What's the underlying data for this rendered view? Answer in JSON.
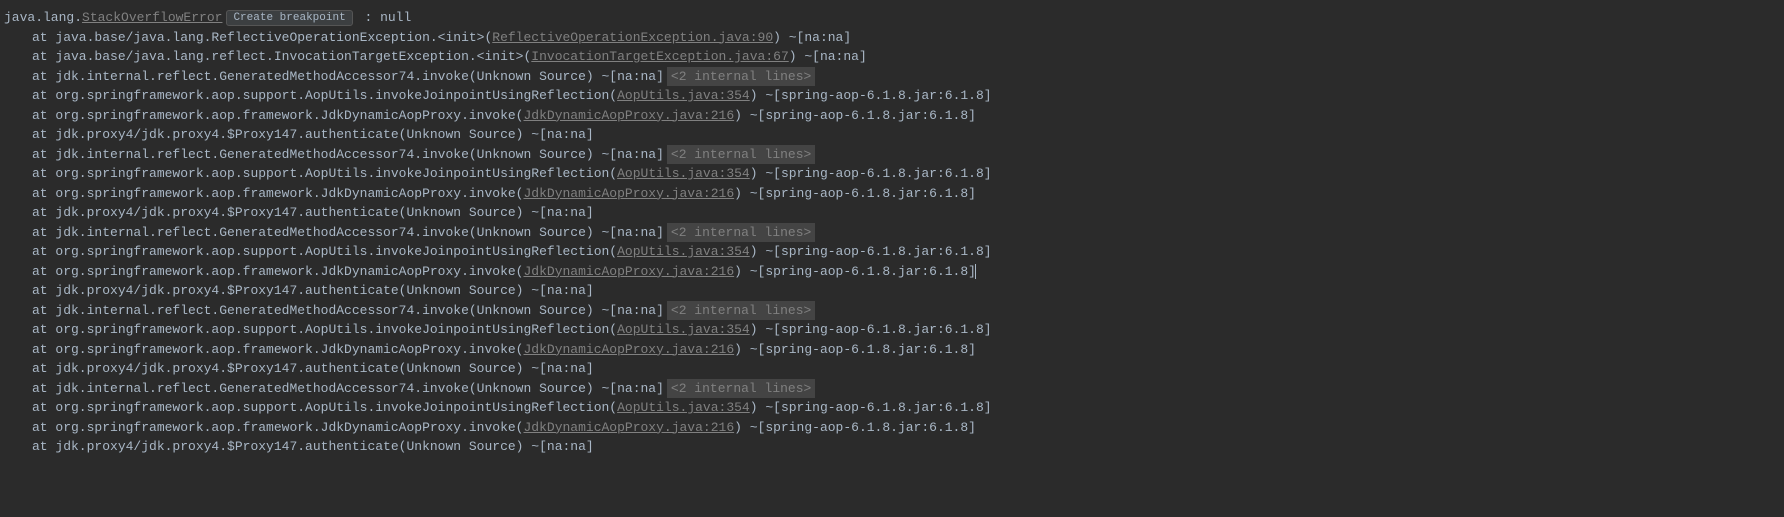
{
  "exception": {
    "packagePrefix": "java.lang.",
    "className": "StackOverflowError",
    "createBreakpointLabel": "Create breakpoint",
    "messageSuffix": " : null"
  },
  "atLabel": "at ",
  "internalLinesBadge": "<2 internal lines>",
  "frames": [
    {
      "prefix": "java.base/java.lang.ReflectiveOperationException.<init>(",
      "linkText": "ReflectiveOperationException.java:90",
      "suffix": ") ~[na:na]",
      "hasBadge": false
    },
    {
      "prefix": "java.base/java.lang.reflect.InvocationTargetException.<init>(",
      "linkText": "InvocationTargetException.java:67",
      "suffix": ") ~[na:na]",
      "hasBadge": false
    },
    {
      "prefix": "jdk.internal.reflect.GeneratedMethodAccessor74.invoke(Unknown Source) ~[na:na]",
      "linkText": "",
      "suffix": "",
      "hasBadge": true
    },
    {
      "prefix": "org.springframework.aop.support.AopUtils.invokeJoinpointUsingReflection(",
      "linkText": "AopUtils.java:354",
      "suffix": ") ~[spring-aop-6.1.8.jar:6.1.8]",
      "hasBadge": false
    },
    {
      "prefix": "org.springframework.aop.framework.JdkDynamicAopProxy.invoke(",
      "linkText": "JdkDynamicAopProxy.java:216",
      "suffix": ") ~[spring-aop-6.1.8.jar:6.1.8]",
      "hasBadge": false
    },
    {
      "prefix": "jdk.proxy4/jdk.proxy4.$Proxy147.authenticate(Unknown Source) ~[na:na]",
      "linkText": "",
      "suffix": "",
      "hasBadge": false
    },
    {
      "prefix": "jdk.internal.reflect.GeneratedMethodAccessor74.invoke(Unknown Source) ~[na:na]",
      "linkText": "",
      "suffix": "",
      "hasBadge": true
    },
    {
      "prefix": "org.springframework.aop.support.AopUtils.invokeJoinpointUsingReflection(",
      "linkText": "AopUtils.java:354",
      "suffix": ") ~[spring-aop-6.1.8.jar:6.1.8]",
      "hasBadge": false
    },
    {
      "prefix": "org.springframework.aop.framework.JdkDynamicAopProxy.invoke(",
      "linkText": "JdkDynamicAopProxy.java:216",
      "suffix": ") ~[spring-aop-6.1.8.jar:6.1.8]",
      "hasBadge": false
    },
    {
      "prefix": "jdk.proxy4/jdk.proxy4.$Proxy147.authenticate(Unknown Source) ~[na:na]",
      "linkText": "",
      "suffix": "",
      "hasBadge": false
    },
    {
      "prefix": "jdk.internal.reflect.GeneratedMethodAccessor74.invoke(Unknown Source) ~[na:na]",
      "linkText": "",
      "suffix": "",
      "hasBadge": true
    },
    {
      "prefix": "org.springframework.aop.support.AopUtils.invokeJoinpointUsingReflection(",
      "linkText": "AopUtils.java:354",
      "suffix": ") ~[spring-aop-6.1.8.jar:6.1.8]",
      "hasBadge": false
    },
    {
      "prefix": "org.springframework.aop.framework.JdkDynamicAopProxy.invoke(",
      "linkText": "JdkDynamicAopProxy.java:216",
      "suffix": ") ~[spring-aop-6.1.8.jar:6.1.8]",
      "hasBadge": false,
      "hasCursor": true
    },
    {
      "prefix": "jdk.proxy4/jdk.proxy4.$Proxy147.authenticate(Unknown Source) ~[na:na]",
      "linkText": "",
      "suffix": "",
      "hasBadge": false
    },
    {
      "prefix": "jdk.internal.reflect.GeneratedMethodAccessor74.invoke(Unknown Source) ~[na:na]",
      "linkText": "",
      "suffix": "",
      "hasBadge": true
    },
    {
      "prefix": "org.springframework.aop.support.AopUtils.invokeJoinpointUsingReflection(",
      "linkText": "AopUtils.java:354",
      "suffix": ") ~[spring-aop-6.1.8.jar:6.1.8]",
      "hasBadge": false
    },
    {
      "prefix": "org.springframework.aop.framework.JdkDynamicAopProxy.invoke(",
      "linkText": "JdkDynamicAopProxy.java:216",
      "suffix": ") ~[spring-aop-6.1.8.jar:6.1.8]",
      "hasBadge": false
    },
    {
      "prefix": "jdk.proxy4/jdk.proxy4.$Proxy147.authenticate(Unknown Source) ~[na:na]",
      "linkText": "",
      "suffix": "",
      "hasBadge": false
    },
    {
      "prefix": "jdk.internal.reflect.GeneratedMethodAccessor74.invoke(Unknown Source) ~[na:na]",
      "linkText": "",
      "suffix": "",
      "hasBadge": true
    },
    {
      "prefix": "org.springframework.aop.support.AopUtils.invokeJoinpointUsingReflection(",
      "linkText": "AopUtils.java:354",
      "suffix": ") ~[spring-aop-6.1.8.jar:6.1.8]",
      "hasBadge": false
    },
    {
      "prefix": "org.springframework.aop.framework.JdkDynamicAopProxy.invoke(",
      "linkText": "JdkDynamicAopProxy.java:216",
      "suffix": ") ~[spring-aop-6.1.8.jar:6.1.8]",
      "hasBadge": false
    },
    {
      "prefix": "jdk.proxy4/jdk.proxy4.$Proxy147.authenticate(Unknown Source) ~[na:na]",
      "linkText": "",
      "suffix": "",
      "hasBadge": false
    }
  ]
}
